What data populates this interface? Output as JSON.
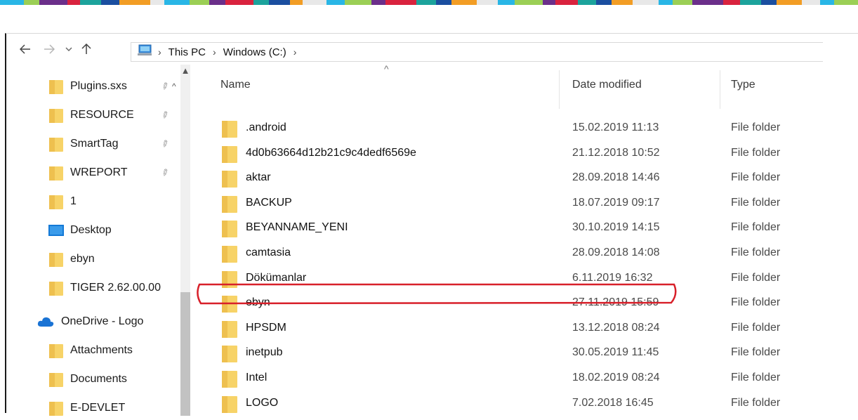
{
  "window": {
    "accent_stripe_colors": [
      "#1b4fa0",
      "#29b6e6",
      "#d9233e",
      "#f29d25",
      "#9bcf55",
      "#1ca39c",
      "#e8e8e8",
      "#6b2f8a"
    ]
  },
  "toolbar": {
    "back_icon": "back-arrow-icon",
    "forward_icon": "forward-arrow-icon",
    "recent_icon": "chevron-down-icon",
    "up_icon": "up-arrow-icon"
  },
  "address": {
    "crumbs": [
      "This PC",
      "Windows (C:)"
    ]
  },
  "sidebar": {
    "items": [
      {
        "label": "Plugins.sxs",
        "icon": "folder-icon",
        "pinned": true
      },
      {
        "label": "RESOURCE",
        "icon": "folder-icon",
        "pinned": true
      },
      {
        "label": "SmartTag",
        "icon": "folder-icon",
        "pinned": true
      },
      {
        "label": "WREPORT",
        "icon": "folder-icon",
        "pinned": true
      },
      {
        "label": "1",
        "icon": "folder-icon",
        "pinned": false
      },
      {
        "label": "Desktop",
        "icon": "desktop-icon",
        "pinned": false
      },
      {
        "label": "ebyn",
        "icon": "folder-icon",
        "pinned": false
      },
      {
        "label": "TIGER 2.62.00.00",
        "icon": "folder-icon",
        "pinned": false
      },
      {
        "label": "OneDrive - Logo",
        "icon": "onedrive-cloud-icon",
        "pinned": false
      },
      {
        "label": "Attachments",
        "icon": "folder-icon",
        "pinned": false
      },
      {
        "label": "Documents",
        "icon": "folder-icon",
        "pinned": false
      },
      {
        "label": "E-DEVLET",
        "icon": "folder-icon",
        "pinned": false
      }
    ]
  },
  "list": {
    "columns": {
      "name": "Name",
      "date": "Date modified",
      "type": "Type"
    },
    "sort": "name-ascending",
    "rows": [
      {
        "name": ".android",
        "date": "15.02.2019 11:13",
        "type": "File folder"
      },
      {
        "name": "4d0b63664d12b21c9c4dedf6569e",
        "date": "21.12.2018 10:52",
        "type": "File folder"
      },
      {
        "name": "aktar",
        "date": "28.09.2018 14:46",
        "type": "File folder"
      },
      {
        "name": "BACKUP",
        "date": "18.07.2019 09:17",
        "type": "File folder"
      },
      {
        "name": "BEYANNAME_YENI",
        "date": "30.10.2019 14:15",
        "type": "File folder"
      },
      {
        "name": "camtasia",
        "date": "28.09.2018 14:08",
        "type": "File folder"
      },
      {
        "name": "Dökümanlar",
        "date": "6.11.2019 16:32",
        "type": "File folder"
      },
      {
        "name": "ebyn",
        "date": "27.11.2019 15:59",
        "type": "File folder",
        "highlighted": true
      },
      {
        "name": "HPSDM",
        "date": "13.12.2018 08:24",
        "type": "File folder"
      },
      {
        "name": "inetpub",
        "date": "30.05.2019 11:45",
        "type": "File folder"
      },
      {
        "name": "Intel",
        "date": "18.02.2019 08:24",
        "type": "File folder"
      },
      {
        "name": "LOGO",
        "date": "7.02.2018 16:45",
        "type": "File folder"
      }
    ]
  },
  "annotation": {
    "color": "#d8202a",
    "target_row": "ebyn"
  }
}
